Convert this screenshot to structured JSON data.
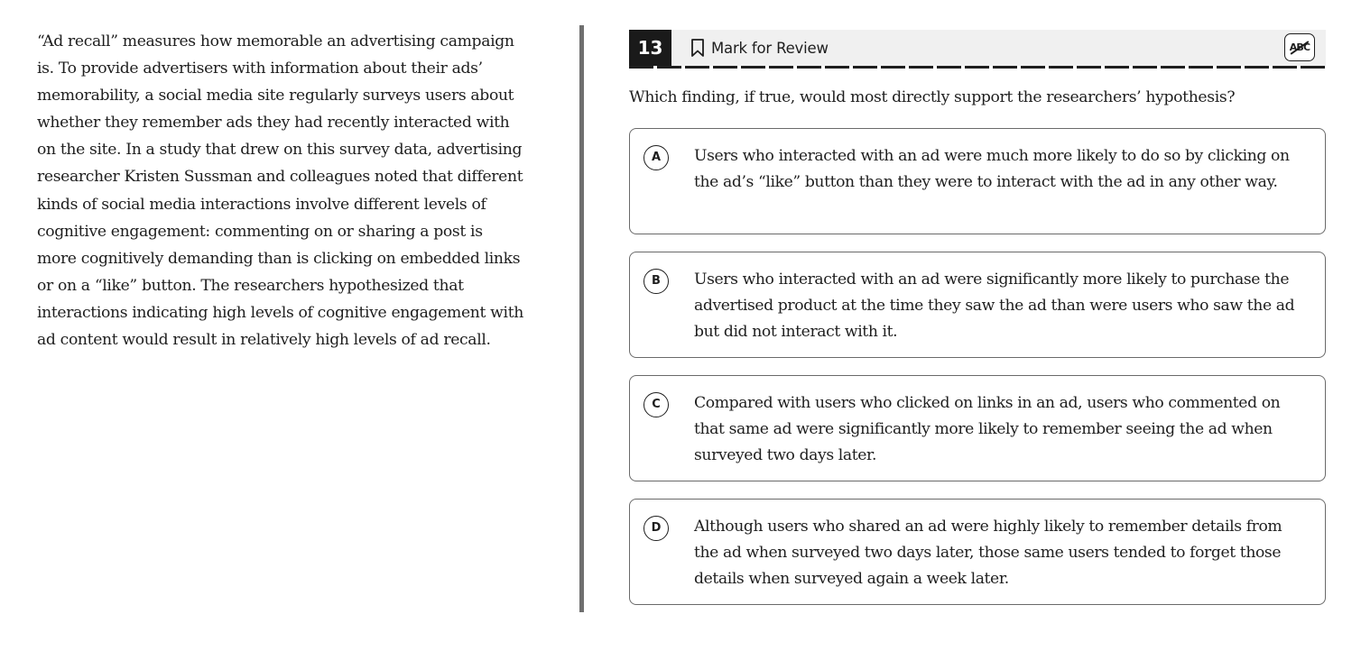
{
  "passage": {
    "text": "“Ad recall” measures how memorable an advertising campaign is. To provide advertisers with information about their ads’ memorability, a social media site regularly surveys users about whether they remember ads they had recently interacted with on the site. In a study that drew on this survey data, advertising researcher Kristen Sussman and colleagues noted that different kinds of social media interactions involve different levels of cognitive engagement: commenting on or sharing a post is more cognitively demanding than is clicking on embedded links or on a “like” button. The researchers hypothesized that interactions indicating high levels of cognitive engagement with ad content would result in relatively high levels of ad recall."
  },
  "header": {
    "question_number": "13",
    "mark_for_review_label": "Mark for Review",
    "mark_icon": "bookmark-icon",
    "eliminator_label": "ABC",
    "eliminator_icon": "answer-eliminator-icon"
  },
  "question": {
    "stem": "Which finding, if true, would most directly support the researchers’ hypothesis?",
    "choices": [
      {
        "letter": "A",
        "text": "Users who interacted with an ad were much more likely to do so by clicking on the ad’s “like” button than they were to interact with the ad in any other way."
      },
      {
        "letter": "B",
        "text": "Users who interacted with an ad were significantly more likely to purchase the advertised product at the time they saw the ad than were users who saw the ad but did not interact with it."
      },
      {
        "letter": "C",
        "text": "Compared with users who clicked on links in an ad, users who commented on that same ad were significantly more likely to remember seeing the ad when surveyed two days later."
      },
      {
        "letter": "D",
        "text": "Although users who shared an ad were highly likely to remember details from the ad when surveyed two days later, those same users tended to forget those details when surveyed again a week later."
      }
    ]
  },
  "colors": {
    "number_badge_bg": "#1a1a1a",
    "header_bg": "#f0f0f0",
    "divider": "#6f6f6f",
    "choice_border": "#6a6a6a",
    "text": "#1e1e1e"
  }
}
